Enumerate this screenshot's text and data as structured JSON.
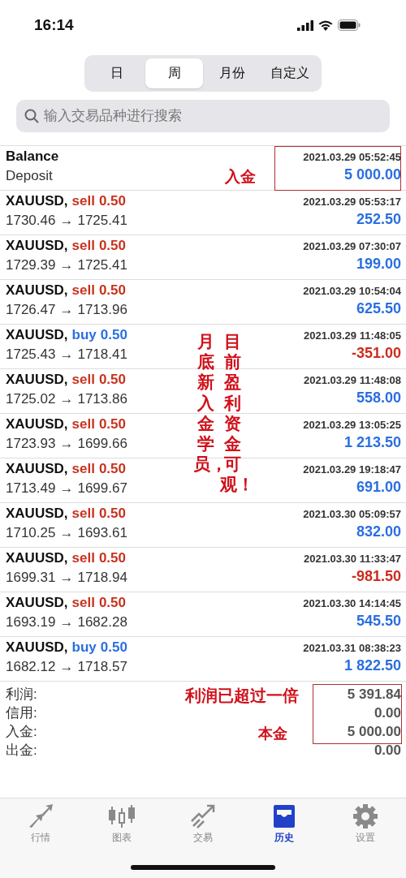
{
  "status_bar": {
    "time": "16:14"
  },
  "period_tabs": [
    {
      "label": "日",
      "selected": false
    },
    {
      "label": "周",
      "selected": true
    },
    {
      "label": "月份",
      "selected": false
    },
    {
      "label": "自定义",
      "selected": false
    }
  ],
  "search": {
    "placeholder": "输入交易品种进行搜索"
  },
  "deposit": {
    "title": "Balance",
    "subtitle": "Deposit",
    "time": "2021.03.29 05:52:45",
    "amount": "5 000.00"
  },
  "trades": [
    {
      "symbol": "XAUUSD,",
      "side": "sell",
      "volume": "0.50",
      "open": "1730.46",
      "arrow": "→",
      "close": "1725.41",
      "time": "2021.03.29 05:53:17",
      "profit": "252.50",
      "loss": false
    },
    {
      "symbol": "XAUUSD,",
      "side": "sell",
      "volume": "0.50",
      "open": "1729.39",
      "arrow": "→",
      "close": "1725.41",
      "time": "2021.03.29 07:30:07",
      "profit": "199.00",
      "loss": false
    },
    {
      "symbol": "XAUUSD,",
      "side": "sell",
      "volume": "0.50",
      "open": "1726.47",
      "arrow": "→",
      "close": "1713.96",
      "time": "2021.03.29 10:54:04",
      "profit": "625.50",
      "loss": false
    },
    {
      "symbol": "XAUUSD,",
      "side": "buy",
      "volume": "0.50",
      "open": "1725.43",
      "arrow": "→",
      "close": "1718.41",
      "time": "2021.03.29 11:48:05",
      "profit": "-351.00",
      "loss": true
    },
    {
      "symbol": "XAUUSD,",
      "side": "sell",
      "volume": "0.50",
      "open": "1725.02",
      "arrow": "→",
      "close": "1713.86",
      "time": "2021.03.29 11:48:08",
      "profit": "558.00",
      "loss": false
    },
    {
      "symbol": "XAUUSD,",
      "side": "sell",
      "volume": "0.50",
      "open": "1723.93",
      "arrow": "→",
      "close": "1699.66",
      "time": "2021.03.29 13:05:25",
      "profit": "1 213.50",
      "loss": false
    },
    {
      "symbol": "XAUUSD,",
      "side": "sell",
      "volume": "0.50",
      "open": "1713.49",
      "arrow": "→",
      "close": "1699.67",
      "time": "2021.03.29 19:18:47",
      "profit": "691.00",
      "loss": false
    },
    {
      "symbol": "XAUUSD,",
      "side": "sell",
      "volume": "0.50",
      "open": "1710.25",
      "arrow": "→",
      "close": "1693.61",
      "time": "2021.03.30 05:09:57",
      "profit": "832.00",
      "loss": false
    },
    {
      "symbol": "XAUUSD,",
      "side": "sell",
      "volume": "0.50",
      "open": "1699.31",
      "arrow": "→",
      "close": "1718.94",
      "time": "2021.03.30 11:33:47",
      "profit": "-981.50",
      "loss": true
    },
    {
      "symbol": "XAUUSD,",
      "side": "sell",
      "volume": "0.50",
      "open": "1693.19",
      "arrow": "→",
      "close": "1682.28",
      "time": "2021.03.30 14:14:45",
      "profit": "545.50",
      "loss": false
    },
    {
      "symbol": "XAUUSD,",
      "side": "buy",
      "volume": "0.50",
      "open": "1682.12",
      "arrow": "→",
      "close": "1718.57",
      "time": "2021.03.31 08:38:23",
      "profit": "1 822.50",
      "loss": false
    }
  ],
  "summary": [
    {
      "label": "利润:",
      "value": "5 391.84"
    },
    {
      "label": "信用:",
      "value": "0.00"
    },
    {
      "label": "入金:",
      "value": "5 000.00"
    },
    {
      "label": "出金:",
      "value": "0.00"
    }
  ],
  "notes": {
    "deposit_note": "入金",
    "right_column_note": "目前盈利资金可观！",
    "left_column_note": "月底新入金学员，",
    "profit_note": "利润已超过一倍",
    "principal_note": "本金"
  },
  "tab_bar": [
    {
      "kind": "quotes",
      "label": "行情",
      "selected": false
    },
    {
      "kind": "chart",
      "label": "图表",
      "selected": false
    },
    {
      "kind": "trade",
      "label": "交易",
      "selected": false
    },
    {
      "kind": "history",
      "label": "历史",
      "selected": true
    },
    {
      "kind": "settings",
      "label": "设置",
      "selected": false
    }
  ]
}
